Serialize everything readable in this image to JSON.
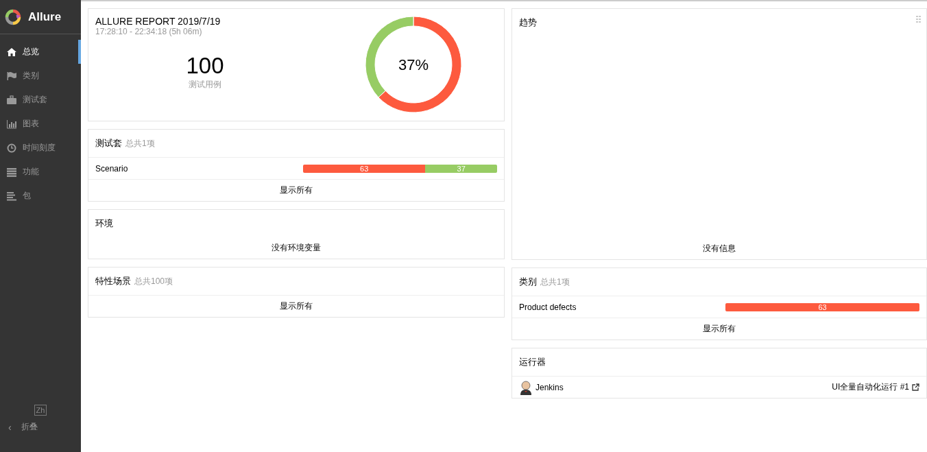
{
  "sidebar": {
    "brand": "Allure",
    "items": [
      {
        "label": "总览",
        "selected": true
      },
      {
        "label": "类别",
        "selected": false
      },
      {
        "label": "测试套",
        "selected": false
      },
      {
        "label": "图表",
        "selected": false
      },
      {
        "label": "时间刻度",
        "selected": false
      },
      {
        "label": "功能",
        "selected": false
      },
      {
        "label": "包",
        "selected": false
      }
    ],
    "language": "Zh",
    "collapse": {
      "arrow": "‹",
      "label": "折叠"
    }
  },
  "summary": {
    "title": "ALLURE REPORT 2019/7/19",
    "time": "17:28:10 - 22:34:18 (5h 06m)",
    "count": "100",
    "count_label": "测试用例",
    "success_rate": "37%",
    "chart_data": {
      "type": "donut",
      "values": [
        63,
        37
      ]
    }
  },
  "suites": {
    "title": "测试套",
    "total": "总共1项",
    "rows": [
      {
        "name": "Scenario",
        "level": 0.63,
        "failed": "63",
        "passed": "37"
      }
    ],
    "show_all": "显示所有"
  },
  "environment": {
    "title": "环境",
    "empty": "没有环境变量"
  },
  "features": {
    "title": "特性场景",
    "total": "总共100项",
    "show_all": "显示所有"
  },
  "trend": {
    "title": "趋势",
    "empty": "没有信息"
  },
  "categories": {
    "title": "类别",
    "total": "总共1项",
    "rows": [
      {
        "name": "Product defects",
        "level": 1,
        "failed": "63"
      }
    ],
    "show_all": "显示所有"
  },
  "executors": {
    "title": "运行器",
    "rows": [
      {
        "name": "Jenkins",
        "build": "UI全量自动化运行 #1"
      }
    ]
  }
}
